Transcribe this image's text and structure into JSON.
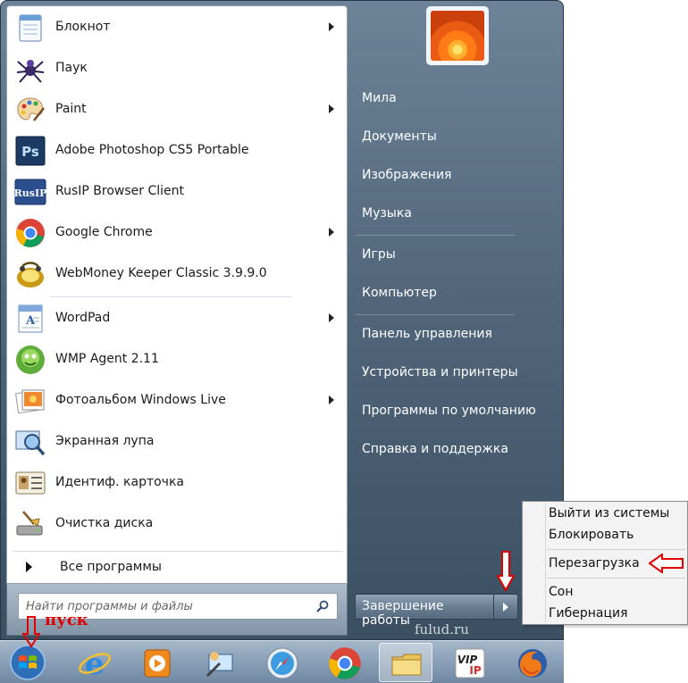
{
  "programs": [
    {
      "label": "Блокнот",
      "icon": "notepad-icon",
      "submenu": true
    },
    {
      "label": "Паук",
      "icon": "spider-solitaire-icon",
      "submenu": false
    },
    {
      "label": "Paint",
      "icon": "paint-palette-icon",
      "submenu": true
    },
    {
      "label": "Adobe Photoshop CS5 Portable",
      "icon": "photoshop-icon",
      "icon_text": "Ps",
      "submenu": false
    },
    {
      "label": "RusIP Browser Client",
      "icon": "rusip-icon",
      "icon_text": "RusIP",
      "submenu": false
    },
    {
      "label": "Google Chrome",
      "icon": "chrome-icon",
      "submenu": true
    },
    {
      "label": "WebMoney Keeper Classic 3.9.9.0",
      "icon": "webmoney-icon",
      "submenu": false
    },
    {
      "label": "WordPad",
      "icon": "wordpad-icon",
      "submenu": true
    },
    {
      "label": "WMP Agent 2.11",
      "icon": "wmp-agent-icon",
      "submenu": false
    },
    {
      "label": "Фотоальбом Windows Live",
      "icon": "photo-gallery-icon",
      "submenu": true
    },
    {
      "label": "Экранная лупа",
      "icon": "magnifier-icon",
      "submenu": false
    },
    {
      "label": "Идентиф. карточка",
      "icon": "id-card-icon",
      "submenu": false
    },
    {
      "label": "Очистка диска",
      "icon": "disk-cleanup-icon",
      "submenu": false
    }
  ],
  "all_programs": "Все программы",
  "search": {
    "placeholder": "Найти программы и файлы"
  },
  "right_links": [
    "Мила",
    "Документы",
    "Изображения",
    "Музыка",
    "Игры",
    "Компьютер",
    "Панель управления",
    "Устройства и принтеры",
    "Программы по умолчанию",
    "Справка и поддержка"
  ],
  "shutdown_label": "Завершение работы",
  "power_menu": [
    "Выйти из системы",
    "Блокировать",
    "Перезагрузка",
    "Сон",
    "Гибернация"
  ],
  "annotation_label": "пуск",
  "watermark": "fulud.ru",
  "icon_labels": {
    "vip_icon_text": "VIP",
    "ip_icon_text": "IP"
  },
  "taskbar": [
    {
      "icon": "windows-start-icon"
    },
    {
      "icon": "internet-explorer-icon"
    },
    {
      "icon": "media-player-icon"
    },
    {
      "icon": "remote-desktop-icon"
    },
    {
      "icon": "safari-icon"
    },
    {
      "icon": "chrome-icon"
    },
    {
      "icon": "folder-icon",
      "active": true
    },
    {
      "icon": "vip-ip-icon"
    },
    {
      "icon": "firefox-icon"
    }
  ],
  "colors": {
    "annotation": "#e00000",
    "menu_blue": "#52677c"
  }
}
